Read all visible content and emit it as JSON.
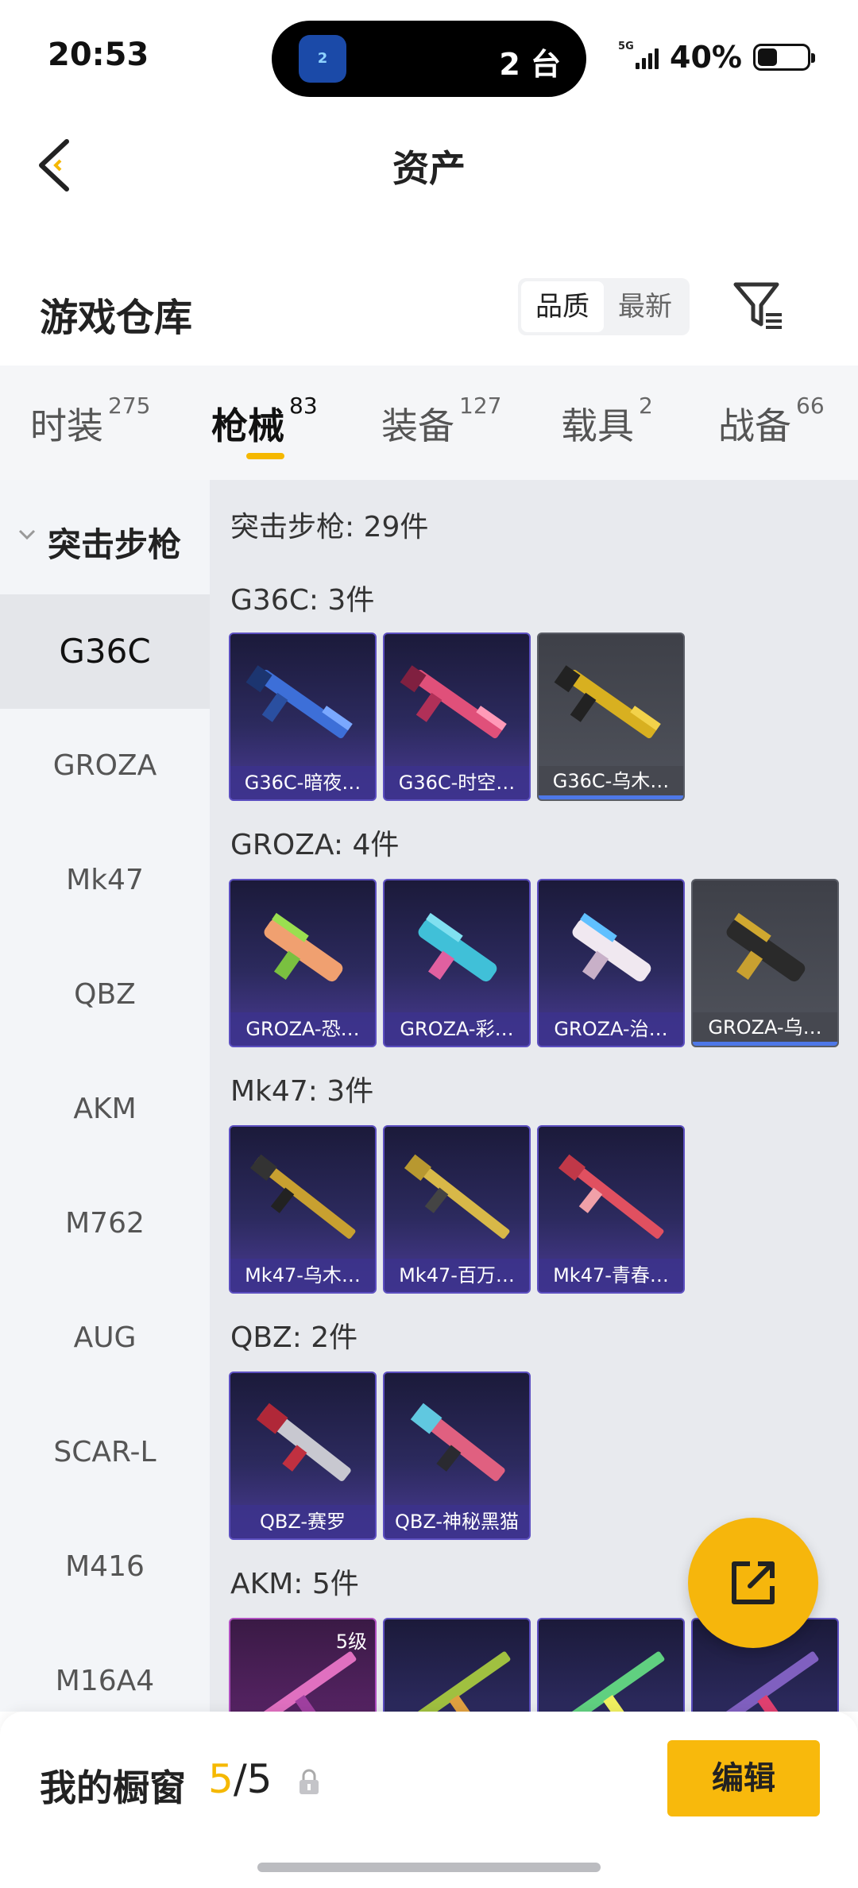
{
  "status_bar": {
    "time": "20:53",
    "island_app_label": "2",
    "island_text": "2 台",
    "network": "5G",
    "battery_pct": "40%",
    "battery_level": 0.4
  },
  "header": {
    "title": "资产"
  },
  "warehouse": {
    "title": "游戏仓库",
    "sort_options": [
      "品质",
      "最新"
    ],
    "sort_selected": "品质"
  },
  "tabs": [
    {
      "label": "时装",
      "count": "275"
    },
    {
      "label": "枪械",
      "count": "83"
    },
    {
      "label": "装备",
      "count": "127"
    },
    {
      "label": "载具",
      "count": "2"
    },
    {
      "label": "战备",
      "count": "66"
    }
  ],
  "active_tab": "枪械",
  "sidebar": {
    "group": "突击步枪",
    "items": [
      "G36C",
      "GROZA",
      "Mk47",
      "QBZ",
      "AKM",
      "M762",
      "AUG",
      "SCAR-L",
      "M416",
      "M16A4"
    ],
    "active_item": "G36C"
  },
  "content": {
    "total": "突击步枪: 29件",
    "groups": [
      {
        "title": "G36C: 3件",
        "items": [
          {
            "name": "G36C-暗夜…",
            "rarity": "purple"
          },
          {
            "name": "G36C-时空…",
            "rarity": "purple"
          },
          {
            "name": "G36C-乌木…",
            "rarity": "grey"
          }
        ]
      },
      {
        "title": "GROZA: 4件",
        "items": [
          {
            "name": "GROZA-恐…",
            "rarity": "purple"
          },
          {
            "name": "GROZA-彩…",
            "rarity": "purple"
          },
          {
            "name": "GROZA-治…",
            "rarity": "purple"
          },
          {
            "name": "GROZA-乌…",
            "rarity": "grey"
          }
        ]
      },
      {
        "title": "Mk47: 3件",
        "items": [
          {
            "name": "Mk47-乌木…",
            "rarity": "purple"
          },
          {
            "name": "Mk47-百万…",
            "rarity": "purple"
          },
          {
            "name": "Mk47-青春…",
            "rarity": "purple"
          }
        ]
      },
      {
        "title": "QBZ: 2件",
        "items": [
          {
            "name": "QBZ-赛罗",
            "rarity": "purple"
          },
          {
            "name": "QBZ-神秘黑猫",
            "rarity": "purple"
          }
        ]
      },
      {
        "title": "AKM: 5件",
        "items": [
          {
            "name": "",
            "rarity": "pink",
            "level": "5级"
          },
          {
            "name": "",
            "rarity": "purple"
          },
          {
            "name": "",
            "rarity": "purple"
          },
          {
            "name": "",
            "rarity": "purple"
          }
        ]
      }
    ]
  },
  "showcase": {
    "label": "我的橱窗",
    "current": "5",
    "separator": "/",
    "max": "5",
    "edit_label": "编辑"
  },
  "colors": {
    "accent": "#f5b800",
    "purple_card": "#2c2a5e",
    "grey_card": "#50535c"
  }
}
